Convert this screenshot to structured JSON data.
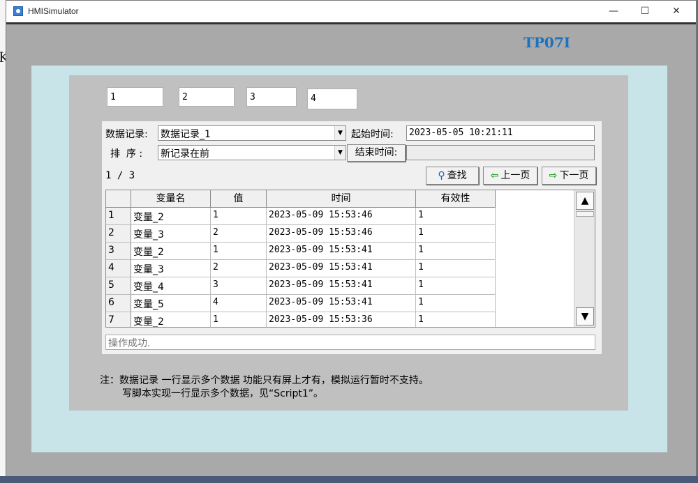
{
  "window": {
    "title": "HMISimulator",
    "minimize": "—",
    "maximize": "☐",
    "close": "✕"
  },
  "background": {
    "letter": "K"
  },
  "screen": {
    "label": "TP07I",
    "io_fields": [
      "1",
      "2",
      "3",
      "4"
    ]
  },
  "record": {
    "record_label": "数据记录:",
    "record_value": "数据记录_1",
    "sort_label": "排  序 :",
    "sort_value": "新记录在前",
    "start_label": "起始时间:",
    "start_value": "2023-05-05 10:21:11",
    "end_label": "结束时间:",
    "end_value": "",
    "page_indicator": "1 / 3",
    "find_label": "查找",
    "prev_label": "上一页",
    "next_label": "下一页",
    "columns": [
      "变量名",
      "值",
      "时间",
      "有效性"
    ],
    "rows": [
      {
        "idx": "1",
        "name": "变量_2",
        "value": "1",
        "time": "2023-05-09 15:53:46",
        "valid": "1"
      },
      {
        "idx": "2",
        "name": "变量_3",
        "value": "2",
        "time": "2023-05-09 15:53:46",
        "valid": "1"
      },
      {
        "idx": "3",
        "name": "变量_2",
        "value": "1",
        "time": "2023-05-09 15:53:41",
        "valid": "1"
      },
      {
        "idx": "4",
        "name": "变量_3",
        "value": "2",
        "time": "2023-05-09 15:53:41",
        "valid": "1"
      },
      {
        "idx": "5",
        "name": "变量_4",
        "value": "3",
        "time": "2023-05-09 15:53:41",
        "valid": "1"
      },
      {
        "idx": "6",
        "name": "变量_5",
        "value": "4",
        "time": "2023-05-09 15:53:41",
        "valid": "1"
      },
      {
        "idx": "7",
        "name": "变量_2",
        "value": "1",
        "time": "2023-05-09 15:53:36",
        "valid": "1"
      }
    ],
    "status": "操作成功."
  },
  "note": {
    "line1": "注：数据记录 一行显示多个数据 功能只有屏上才有，模拟运行暂时不支持。",
    "line2": "写脚本实现一行显示多个数据，见“Script1”。"
  }
}
